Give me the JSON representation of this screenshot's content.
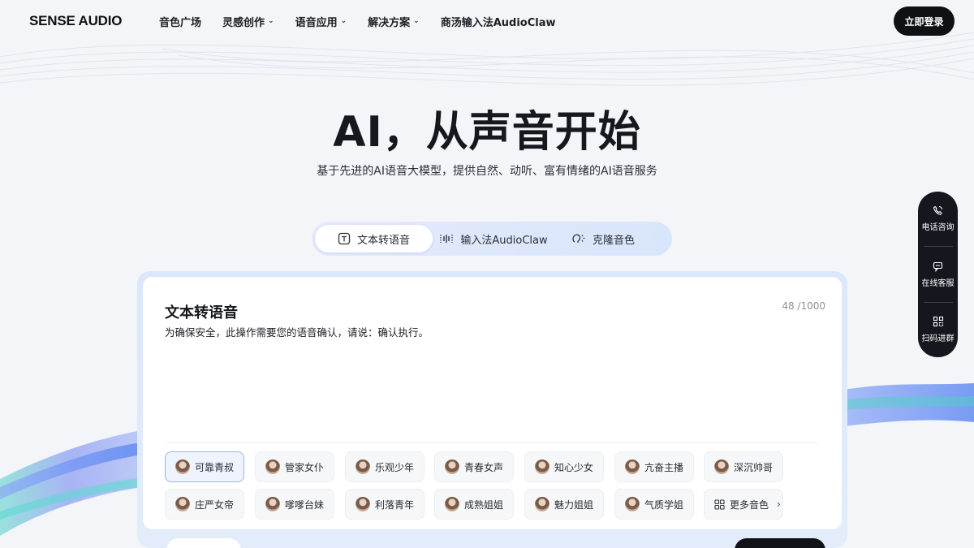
{
  "brand": "SENSE AUDIO",
  "nav": {
    "items": [
      {
        "label": "音色广场",
        "has_dropdown": false
      },
      {
        "label": "灵感创作",
        "has_dropdown": true
      },
      {
        "label": "语音应用",
        "has_dropdown": true
      },
      {
        "label": "解决方案",
        "has_dropdown": true
      },
      {
        "label": "商汤输入法AudioClaw",
        "has_dropdown": false
      }
    ],
    "login_label": "立即登录"
  },
  "hero": {
    "title": "AI，从声音开始",
    "subtitle": "基于先进的AI语音大模型，提供自然、动听、富有情绪的AI语音服务"
  },
  "tabs": [
    {
      "label": "文本转语音",
      "icon": "text-to-speech-icon",
      "active": true
    },
    {
      "label": "输入法AudioClaw",
      "icon": "voice-wave-icon",
      "active": false
    },
    {
      "label": "克隆音色",
      "icon": "voice-clone-icon",
      "active": false
    }
  ],
  "editor": {
    "title": "文本转语音",
    "count": "48 /1000",
    "text": "为确保安全，此操作需要您的语音确认，请说：确认执行。"
  },
  "voices": [
    {
      "label": "可靠青叔",
      "selected": true
    },
    {
      "label": "管家女仆",
      "selected": false
    },
    {
      "label": "乐观少年",
      "selected": false
    },
    {
      "label": "青春女声",
      "selected": false
    },
    {
      "label": "知心少女",
      "selected": false
    },
    {
      "label": "亢奋主播",
      "selected": false
    },
    {
      "label": "深沉帅哥",
      "selected": false
    },
    {
      "label": "庄严女帝",
      "selected": false
    },
    {
      "label": "嗲嗲台妹",
      "selected": false
    },
    {
      "label": "利落青年",
      "selected": false
    },
    {
      "label": "成熟姐姐",
      "selected": false
    },
    {
      "label": "魅力姐姐",
      "selected": false
    },
    {
      "label": "气质学姐",
      "selected": false
    }
  ],
  "more_voices_label": "更多音色",
  "side_panel": [
    {
      "label": "电话咨询",
      "icon": "phone-icon"
    },
    {
      "label": "在线客服",
      "icon": "chat-icon"
    },
    {
      "label": "扫码进群",
      "icon": "qr-scan-icon"
    }
  ],
  "colors": {
    "accent_dark": "#0f1115",
    "selected_border": "#9db4e6",
    "wave_blue": "#5f7cf0",
    "wave_cyan": "#5fd8d0"
  }
}
